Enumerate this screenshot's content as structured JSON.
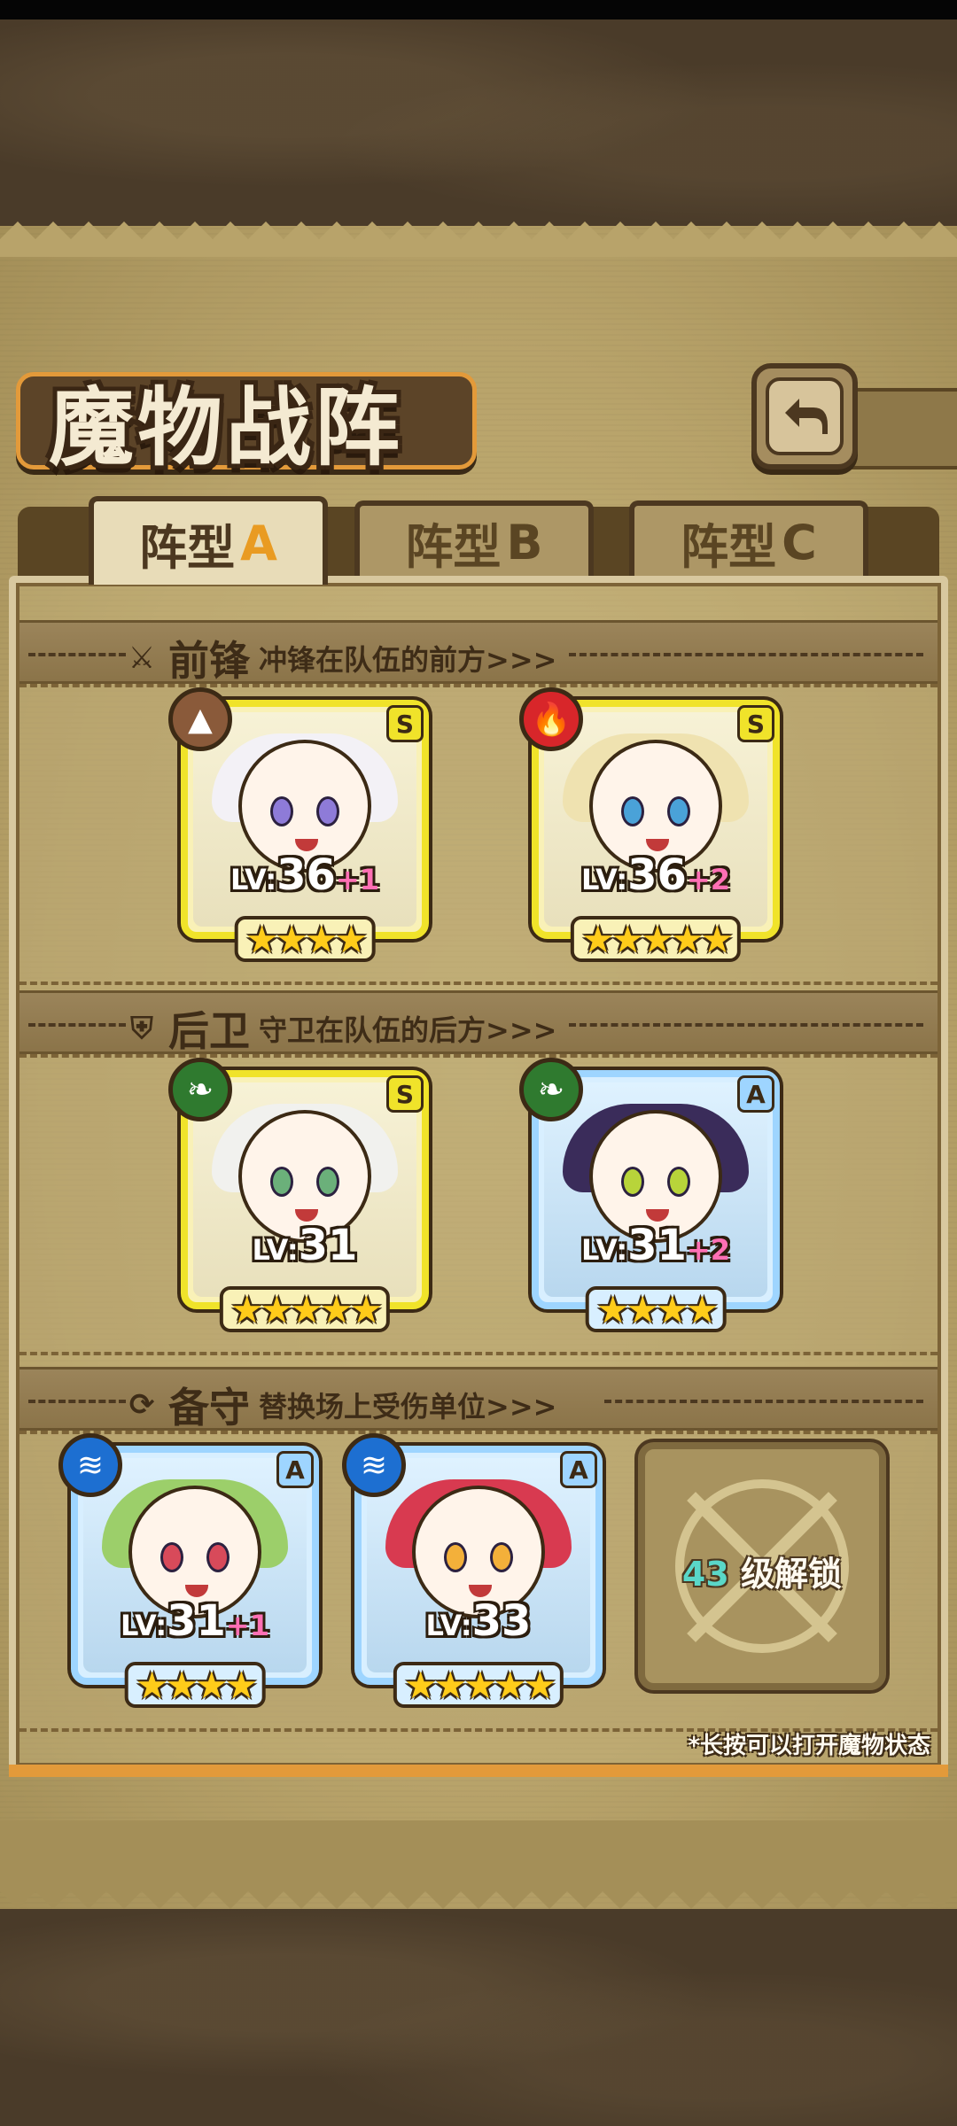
{
  "title": "魔物战阵",
  "tabs": [
    {
      "label": "阵型",
      "letter": "A",
      "active": true
    },
    {
      "label": "阵型",
      "letter": "B",
      "active": false
    },
    {
      "label": "阵型",
      "letter": "C",
      "active": false
    }
  ],
  "sections": {
    "front": {
      "name": "前锋",
      "desc": "冲锋在队伍的前方>>>",
      "icon": "sword-icon"
    },
    "back": {
      "name": "后卫",
      "desc": "守卫在队伍的后方>>>",
      "icon": "shield-icon"
    },
    "reserve": {
      "name": "备守",
      "desc": "替换场上受伤单位>>>",
      "icon": "swap-icon"
    }
  },
  "front_cards": [
    {
      "rank": "S",
      "element": "earth-element-icon",
      "element_color": "#8a5a3a",
      "lv_prefix": "LV:",
      "lv": "36",
      "bonus": "+1",
      "stars": 4,
      "hair": "#f3f1f6",
      "eye": "#8e7bd8"
    },
    {
      "rank": "S",
      "element": "fire-element-icon",
      "element_color": "#d8262a",
      "lv_prefix": "LV:",
      "lv": "36",
      "bonus": "+2",
      "stars": 5,
      "hair": "#efe2b0",
      "eye": "#4aa2d8"
    }
  ],
  "back_cards": [
    {
      "rank": "S",
      "element": "leaf-element-icon",
      "element_color": "#2f7a2f",
      "lv_prefix": "LV:",
      "lv": "31",
      "bonus": "",
      "stars": 5,
      "hair": "#f1f1ee",
      "eye": "#6bb07a"
    },
    {
      "rank": "A",
      "element": "leaf-element-icon",
      "element_color": "#2f7a2f",
      "lv_prefix": "LV:",
      "lv": "31",
      "bonus": "+2",
      "stars": 4,
      "hair": "#3a2c5a",
      "eye": "#b8d43a"
    }
  ],
  "reserve_cards": [
    {
      "rank": "A",
      "element": "water-element-icon",
      "element_color": "#1d6fd1",
      "lv_prefix": "LV:",
      "lv": "31",
      "bonus": "+1",
      "stars": 4,
      "hair": "#9ccf6a",
      "eye": "#d84a5a"
    },
    {
      "rank": "A",
      "element": "water-element-icon",
      "element_color": "#1d6fd1",
      "lv_prefix": "LV:",
      "lv": "33",
      "bonus": "",
      "stars": 5,
      "hair": "#d83a50",
      "eye": "#f3b03a"
    }
  ],
  "locked_slot": {
    "level": "43",
    "text": "级解锁"
  },
  "hint": "*长按可以打开魔物状态"
}
